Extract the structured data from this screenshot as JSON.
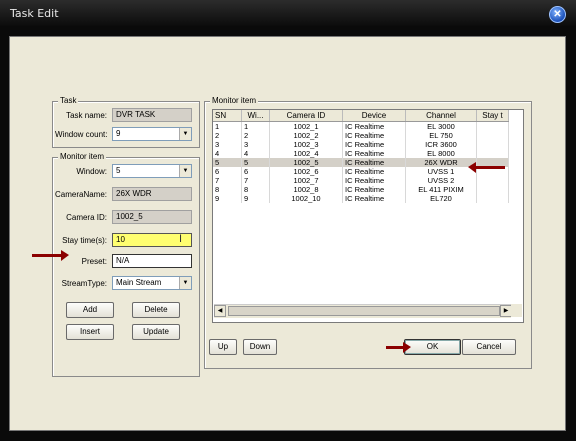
{
  "window": {
    "title": "Task Edit",
    "close_icon": "close-icon"
  },
  "task": {
    "group_title": "Task",
    "task_name_label": "Task name:",
    "task_name_value": "DVR TASK",
    "window_count_label": "Window count:",
    "window_count_value": "9"
  },
  "monitor_form": {
    "group_title": "Monitor item",
    "window_label": "Window:",
    "window_value": "5",
    "camera_name_label": "CameraName:",
    "camera_name_value": "26X WDR",
    "camera_id_label": "Camera ID:",
    "camera_id_value": "1002_5",
    "stay_time_label": "Stay time(s):",
    "stay_time_value": "10",
    "preset_label": "Preset:",
    "preset_value": "N/A",
    "stream_type_label": "StreamType:",
    "stream_type_value": "Main Stream",
    "add": "Add",
    "delete": "Delete",
    "insert": "Insert",
    "update": "Update"
  },
  "monitor_list": {
    "group_title": "Monitor item",
    "columns": [
      "SN",
      "Wi...",
      "Camera ID",
      "Device",
      "Channel",
      "Stay t"
    ],
    "rows": [
      [
        "1",
        "1",
        "1002_1",
        "IC Realtime",
        "EL 3000",
        ""
      ],
      [
        "2",
        "2",
        "1002_2",
        "IC Realtime",
        "EL 750",
        ""
      ],
      [
        "3",
        "3",
        "1002_3",
        "IC Realtime",
        "ICR 3600",
        ""
      ],
      [
        "4",
        "4",
        "1002_4",
        "IC Realtime",
        "EL 8000",
        ""
      ],
      [
        "5",
        "5",
        "1002_5",
        "IC Realtime",
        "26X WDR",
        ""
      ],
      [
        "6",
        "6",
        "1002_6",
        "IC Realtime",
        "UVSS 1",
        ""
      ],
      [
        "7",
        "7",
        "1002_7",
        "IC Realtime",
        "UVSS 2",
        ""
      ],
      [
        "8",
        "8",
        "1002_8",
        "IC Realtime",
        "EL 411 PIXIM",
        ""
      ],
      [
        "9",
        "9",
        "1002_10",
        "IC Realtime",
        "EL720",
        ""
      ]
    ],
    "selected_row": 4
  },
  "buttons": {
    "up": "Up",
    "down": "Down",
    "ok": "OK",
    "cancel": "Cancel"
  }
}
